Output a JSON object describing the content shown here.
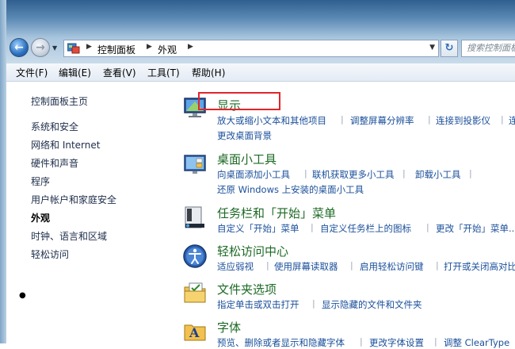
{
  "addressbar": {
    "crumbs": [
      "控制面板",
      "外观"
    ],
    "search_placeholder": "搜索控制面板"
  },
  "menubar": {
    "items": [
      "文件(F)",
      "编辑(E)",
      "查看(V)",
      "工具(T)",
      "帮助(H)"
    ]
  },
  "leftnav": {
    "home": "控制面板主页",
    "items": [
      "系统和安全",
      "网络和 Internet",
      "硬件和声音",
      "程序",
      "用户帐户和家庭安全",
      "外观",
      "时钟、语言和区域",
      "轻松访问"
    ],
    "current_index": 5
  },
  "categories": [
    {
      "title": "显示",
      "icon": "display-monitor-icon",
      "tasks": [
        "放大或缩小文本和其他项目",
        "调整屏幕分辨率",
        "连接到投影仪",
        "连",
        "更改桌面背景"
      ]
    },
    {
      "title": "桌面小工具",
      "icon": "desktop-gadgets-icon",
      "tasks": [
        "向桌面添加小工具",
        "联机获取更多小工具",
        "卸载小工具",
        "还原 Windows 上安装的桌面小工具"
      ]
    },
    {
      "title": "任务栏和「开始」菜单",
      "icon": "taskbar-icon",
      "tasks": [
        "自定义「开始」菜单",
        "自定义任务栏上的图标",
        "更改「开始」菜单..."
      ]
    },
    {
      "title": "轻松访问中心",
      "icon": "ease-of-access-icon",
      "tasks": [
        "适应弱视",
        "使用屏幕读取器",
        "启用轻松访问键",
        "打开或关闭高对比"
      ]
    },
    {
      "title": "文件夹选项",
      "icon": "folder-options-icon",
      "tasks": [
        "指定单击或双击打开",
        "显示隐藏的文件和文件夹"
      ]
    },
    {
      "title": "字体",
      "icon": "fonts-icon",
      "tasks": [
        "预览、删除或者显示和隐藏字体",
        "更改字体设置",
        "调整 ClearType"
      ]
    }
  ],
  "colors": {
    "category_title": "#1d6a25",
    "task_link": "#1a4f9a",
    "highlight_box": "#e0262b"
  }
}
